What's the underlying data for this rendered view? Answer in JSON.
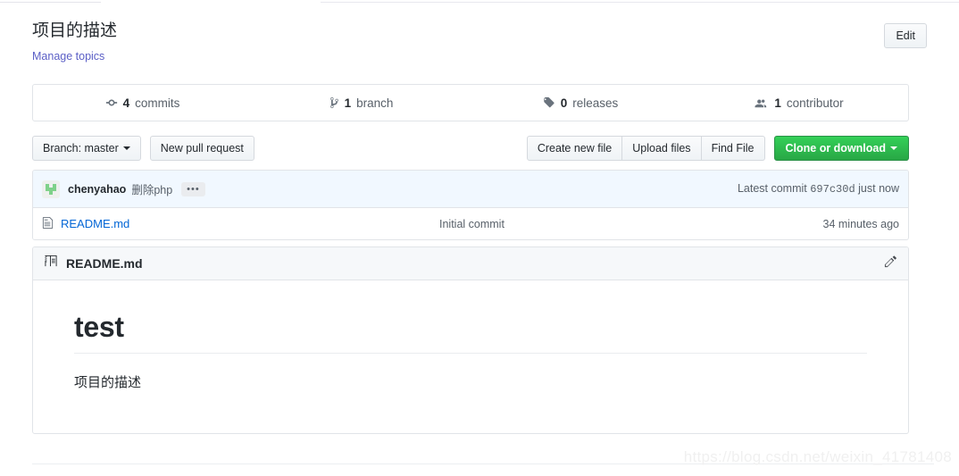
{
  "header": {
    "description": "项目的描述",
    "manage_topics_label": "Manage topics",
    "edit_button_label": "Edit"
  },
  "numbers": [
    {
      "icon": "commit-icon",
      "count": "4",
      "label": "commits",
      "name": "commits-stat"
    },
    {
      "icon": "branch-icon",
      "count": "1",
      "label": "branch",
      "name": "branches-stat"
    },
    {
      "icon": "tag-icon",
      "count": "0",
      "label": "releases",
      "name": "releases-stat"
    },
    {
      "icon": "people-icon",
      "count": "1",
      "label": "contributor",
      "name": "contributors-stat"
    }
  ],
  "toolbar": {
    "branch_button_label": "Branch: master",
    "new_pull_request_label": "New pull request",
    "create_new_file_label": "Create new file",
    "upload_files_label": "Upload files",
    "find_file_label": "Find File",
    "clone_or_download_label": "Clone or download"
  },
  "commit_row": {
    "avatar_name": "identicon-avatar",
    "author": "chenyahao",
    "message": "删除php",
    "dots_label": "•••",
    "latest_commit_prefix": "Latest commit",
    "sha": "697c30d",
    "time": "just now"
  },
  "files": [
    {
      "icon": "file-icon",
      "name": "README.md",
      "commit_message": "Initial commit",
      "age": "34 minutes ago"
    }
  ],
  "readme": {
    "icon": "book-icon",
    "title": "README.md",
    "edit_icon": "pencil-icon",
    "heading": "test",
    "paragraph": "项目的描述"
  },
  "watermark": {
    "text": "https://blog.csdn.net/weixin_41781408"
  },
  "colors": {
    "link": "#0366d6",
    "topic_link": "#5b5fc6",
    "green_button": "#28a745",
    "muted_text": "#586069",
    "border": "#e1e4e8",
    "commit_row_bg": "#f1f8ff",
    "readme_head_bg": "#f6f8fa",
    "avatar_green": "#7fd18a"
  }
}
